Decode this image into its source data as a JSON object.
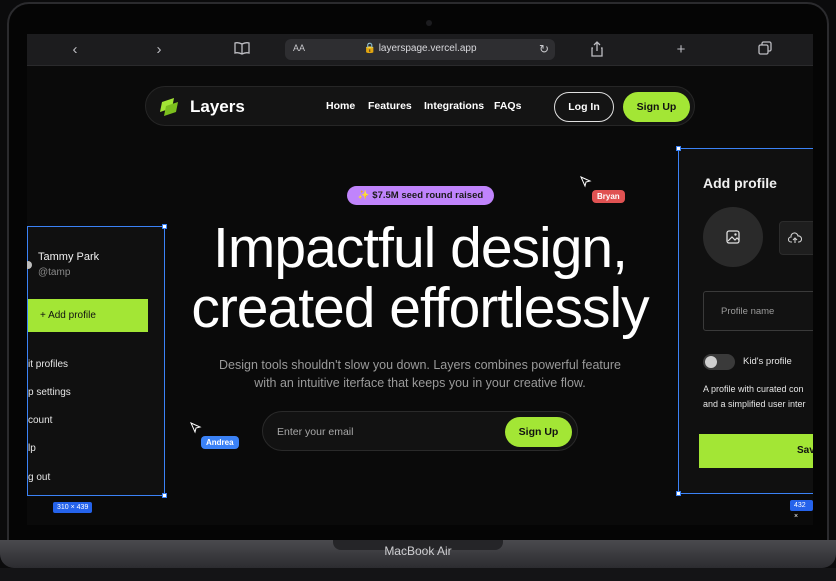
{
  "browser": {
    "url_aa": "AA",
    "url": "layerspage.vercel.app"
  },
  "device": {
    "label": "MacBook Air"
  },
  "nav": {
    "brand": "Layers",
    "links": [
      "Home",
      "Features",
      "Integrations",
      "FAQs"
    ],
    "login": "Log In",
    "signup": "Sign Up"
  },
  "hero": {
    "badge": "✨ $7.5M seed round raised",
    "headline_line1": "Impactful design,",
    "headline_line2": "created effortlessly",
    "subtext_line1": "Design tools shouldn't slow you down. Layers combines powerful feature",
    "subtext_line2": "with an intuitive iterface that keeps you in your creative flow.",
    "email_placeholder": "Enter your email",
    "email_button": "Sign Up"
  },
  "cursors": [
    {
      "name": "Bryan",
      "color": "#e05252"
    },
    {
      "name": "Andrea",
      "color": "#3b82f6"
    }
  ],
  "left_panel": {
    "user_name": "Tammy Park",
    "user_handle": "@tamp",
    "add_profile": "+ Add profile",
    "items": [
      "it profiles",
      "p settings",
      "count",
      "lp",
      "g out"
    ],
    "dimensions": "310 × 439"
  },
  "right_panel": {
    "title": "Add profile",
    "profile_name_placeholder": "Profile name",
    "kids_toggle_label": "Kid's profile",
    "desc_line1": "A profile with curated con",
    "desc_line2": "and a simplified user inter",
    "save": "Sav",
    "dimensions": "432 ×"
  },
  "colors": {
    "accent": "#a3e635",
    "badge": "#c084fc",
    "selection": "#3b82f6"
  }
}
